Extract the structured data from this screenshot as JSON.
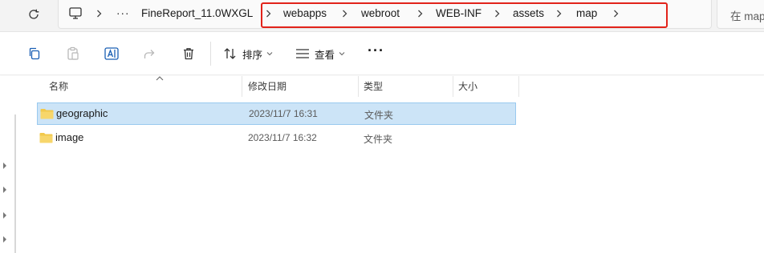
{
  "address_bar": {
    "breadcrumbs": [
      "FineReport_11.0WXGL",
      "webapps",
      "webroot",
      "WEB-INF",
      "assets",
      "map"
    ],
    "more_label": "···",
    "search_placeholder": "在 map"
  },
  "command_bar": {
    "sort_label": "排序",
    "view_label": "查看",
    "more_label": "···"
  },
  "file_list": {
    "columns": [
      "名称",
      "修改日期",
      "类型",
      "大小"
    ],
    "rows": [
      {
        "name": "geographic",
        "modified": "2023/11/7 16:31",
        "type": "文件夹",
        "size": "",
        "selected": true
      },
      {
        "name": "image",
        "modified": "2023/11/7 16:32",
        "type": "文件夹",
        "size": "",
        "selected": false
      }
    ]
  },
  "colors": {
    "highlight_box": "#e2231a",
    "selection": "#cce4f7",
    "folder": "#f2c94c"
  }
}
